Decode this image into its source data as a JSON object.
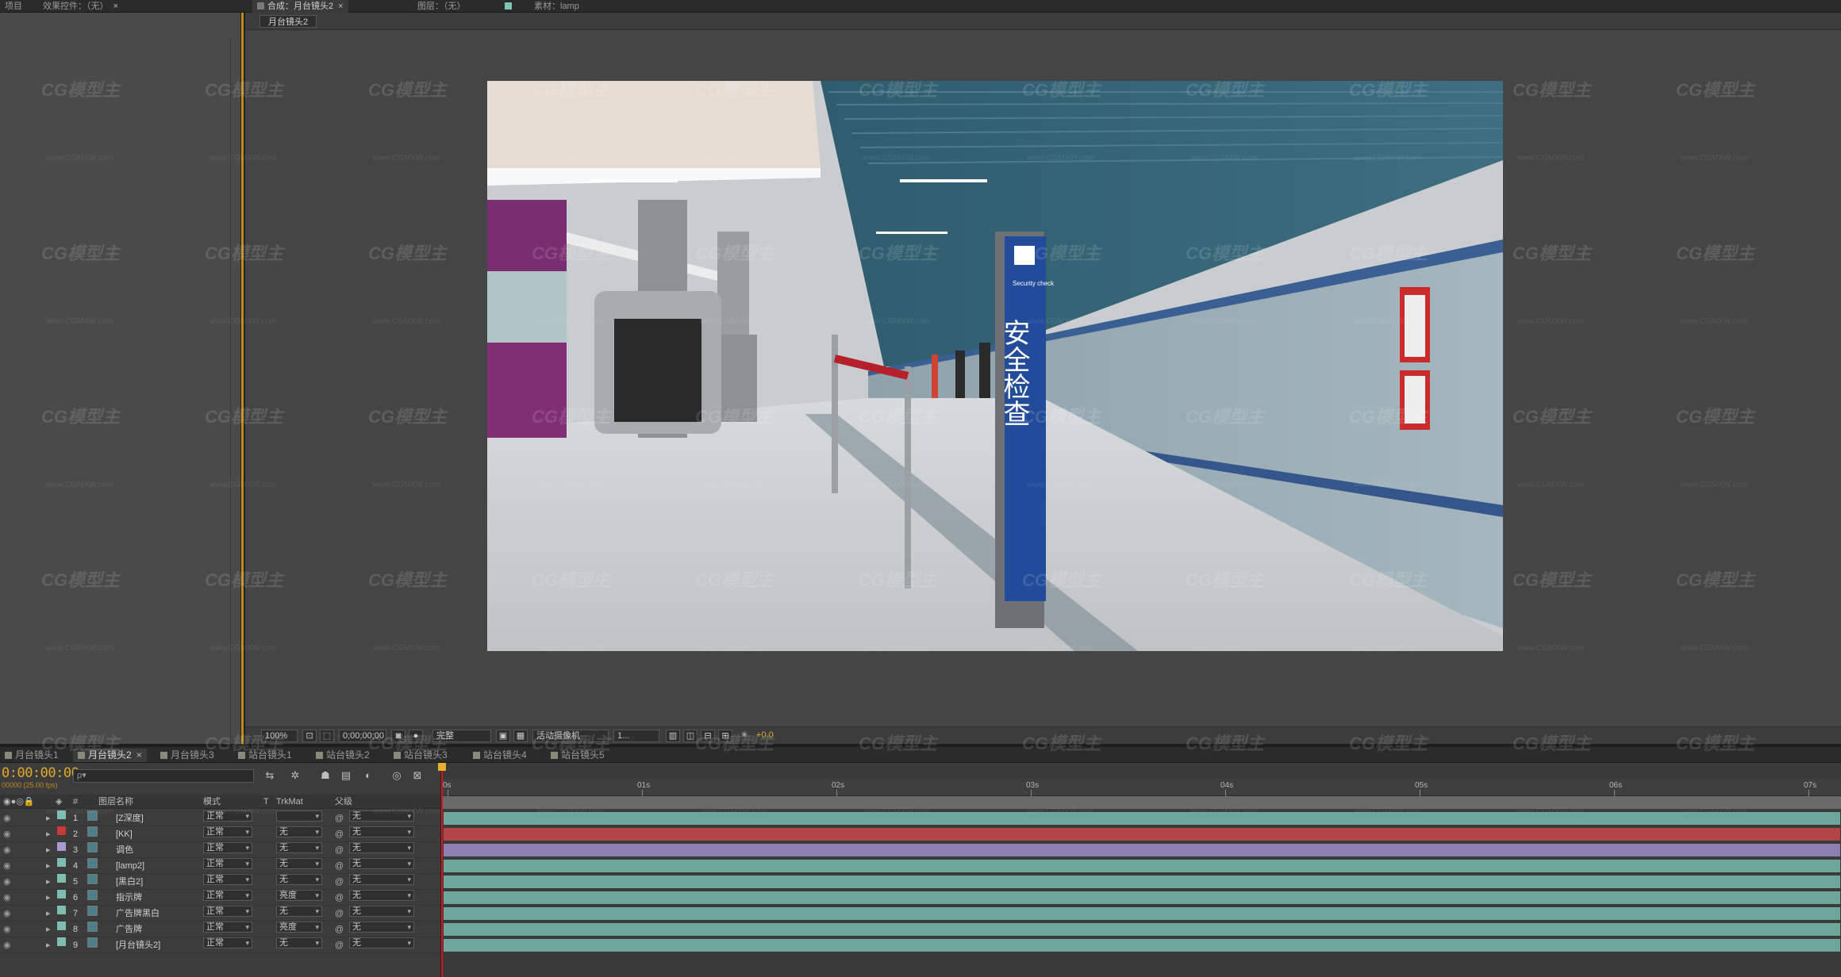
{
  "top_tabs": {
    "project": "项目",
    "effects": "效果控件：（无）",
    "composition": "合成：月台镜头2",
    "layer": "图层：（无）",
    "footage": "素材：lamp"
  },
  "viewer": {
    "comp_tab": "月台镜头2",
    "zoom": "100%",
    "time": "0;00;00;00",
    "resolution": "完整",
    "camera": "活动摄像机",
    "views": "1...",
    "exposure": "+0.0"
  },
  "scene": {
    "sign_en": "Security check",
    "sign_cn": "安全检查"
  },
  "timeline": {
    "tabs": [
      "月台镜头1",
      "月台镜头2",
      "月台镜头3",
      "站台镜头1",
      "站台镜头2",
      "站台镜头3",
      "站台镜头4",
      "站台镜头5"
    ],
    "active_tab": 1,
    "timecode": "0:00:00:00",
    "frames": "00000 (25.00 fps)",
    "search_placeholder": "ρ▾",
    "columns": {
      "num": "#",
      "name": "图层名称",
      "mode": "模式",
      "t": "T",
      "trkmat": "TrkMat",
      "parent": "父级"
    },
    "ruler": [
      "0s",
      "01s",
      "02s",
      "03s",
      "04s",
      "05s",
      "06s",
      "07s"
    ],
    "layers": [
      {
        "num": "1",
        "name": "[Z深度]",
        "mode": "正常",
        "trkmat": "",
        "parent": "无",
        "label_color": "#7fbdb2",
        "bar_color": "#6fa69b"
      },
      {
        "num": "2",
        "name": "[KK]",
        "mode": "正常",
        "trkmat": "无",
        "parent": "无",
        "label_color": "#c83a3a",
        "bar_color": "#b24545"
      },
      {
        "num": "3",
        "name": "调色",
        "mode": "正常",
        "trkmat": "无",
        "parent": "无",
        "label_color": "#a79bd0",
        "bar_color": "#8a80b2"
      },
      {
        "num": "4",
        "name": "[lamp2]",
        "mode": "正常",
        "trkmat": "无",
        "parent": "无",
        "label_color": "#7fbdb2",
        "bar_color": "#6fa69b"
      },
      {
        "num": "5",
        "name": "[黑白2]",
        "mode": "正常",
        "trkmat": "无",
        "parent": "无",
        "label_color": "#7fbdb2",
        "bar_color": "#6fa69b"
      },
      {
        "num": "6",
        "name": "指示牌",
        "mode": "正常",
        "trkmat": "亮度",
        "parent": "无",
        "label_color": "#7fbdb2",
        "bar_color": "#6fa69b"
      },
      {
        "num": "7",
        "name": "广告牌黑白",
        "mode": "正常",
        "trkmat": "无",
        "parent": "无",
        "label_color": "#7fbdb2",
        "bar_color": "#6fa69b"
      },
      {
        "num": "8",
        "name": "广告牌",
        "mode": "正常",
        "trkmat": "亮度",
        "parent": "无",
        "label_color": "#7fbdb2",
        "bar_color": "#6fa69b"
      },
      {
        "num": "9",
        "name": "[月台镜头2]",
        "mode": "正常",
        "trkmat": "无",
        "parent": "无",
        "label_color": "#7fbdb2",
        "bar_color": "#6fa69b"
      }
    ]
  },
  "watermark": {
    "logo": "CG模型主",
    "url": "www.CGMXW.com"
  }
}
